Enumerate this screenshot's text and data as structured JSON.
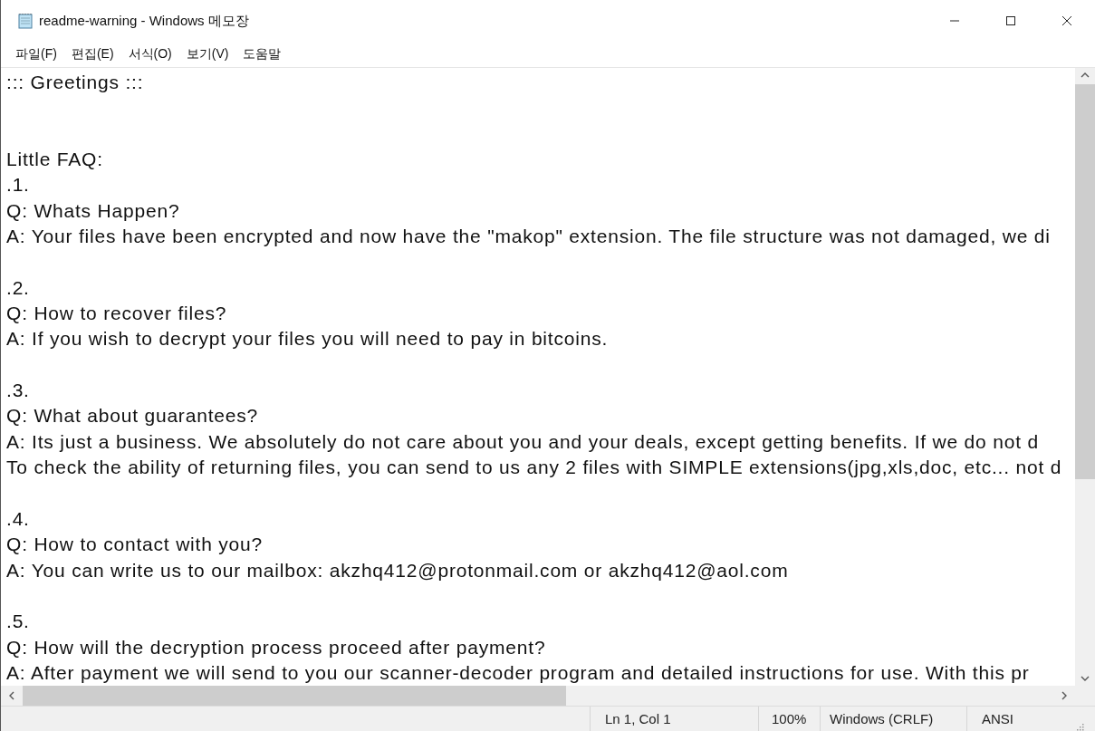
{
  "window": {
    "title": "readme-warning - Windows 메모장"
  },
  "menu": [
    {
      "label": "파일(F)"
    },
    {
      "label": "편집(E)"
    },
    {
      "label": "서식(O)"
    },
    {
      "label": "보기(V)"
    },
    {
      "label": "도움말"
    }
  ],
  "document": {
    "heading": "::: Greetings :::",
    "intro": "Little FAQ:",
    "faq": [
      {
        "number": ".1.",
        "lines": [
          "Q: Whats Happen?",
          "A: Your files have been encrypted and now have the \"makop\" extension. The file structure was not damaged, we di"
        ]
      },
      {
        "number": ".2.",
        "lines": [
          "Q: How to recover files?",
          "A: If you wish to decrypt your files you will need to pay in bitcoins."
        ]
      },
      {
        "number": ".3.",
        "lines": [
          "Q: What about guarantees?",
          "A: Its just a business. We absolutely do not care about you and your deals, except getting benefits. If we do not d",
          "To check the ability of returning files, you can send to us any 2 files with SIMPLE extensions(jpg,xls,doc, etc... not d"
        ]
      },
      {
        "number": ".4.",
        "lines": [
          "Q: How to contact with you?",
          "A: You can write us to our mailbox: akzhq412@protonmail.com or akzhq412@aol.com"
        ]
      },
      {
        "number": ".5.",
        "lines": [
          "Q: How will the decryption process proceed after payment?",
          "A: After payment we will send to you our scanner-decoder program and detailed instructions for use. With this pr"
        ]
      }
    ]
  },
  "status_bar": {
    "position": "Ln 1, Col 1",
    "zoom": "100%",
    "line_ending": "Windows (CRLF)",
    "encoding": "ANSI"
  }
}
